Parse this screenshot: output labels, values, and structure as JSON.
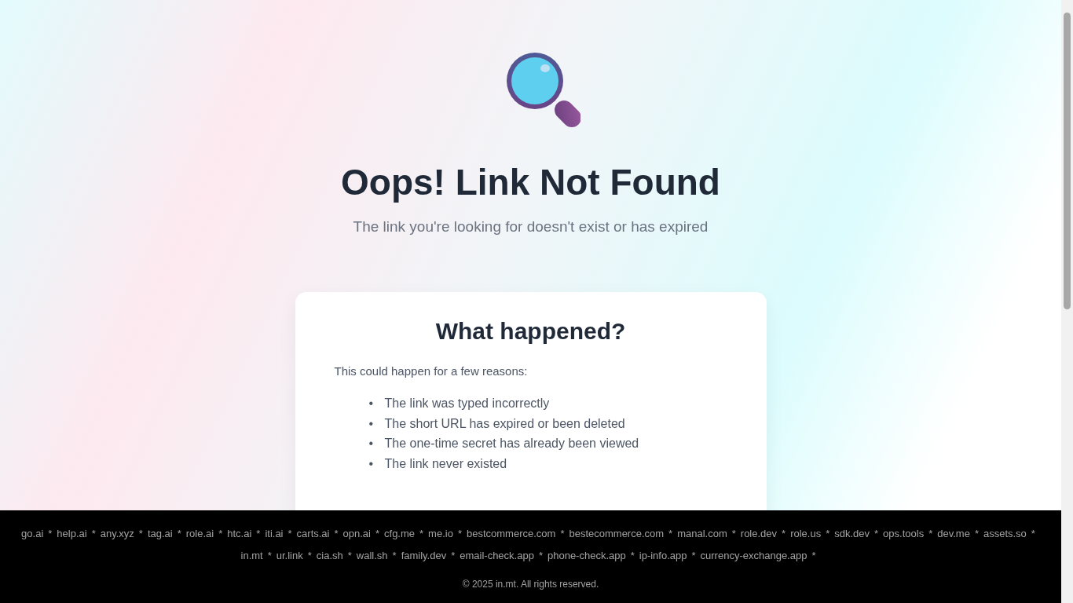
{
  "hero": {
    "title": "Oops! Link Not Found",
    "subtitle": "The link you're looking for doesn't exist or has expired"
  },
  "card": {
    "heading": "What happened?",
    "intro": "This could happen for a few reasons:",
    "reasons": [
      {
        "bullet": "•",
        "text": "The link was typed incorrectly"
      },
      {
        "bullet": "•",
        "text": "The short URL has expired or been deleted"
      },
      {
        "bullet": "•",
        "text": "The one-time secret has already been viewed"
      },
      {
        "bullet": "•",
        "text": "The link never existed"
      }
    ]
  },
  "footer": {
    "links": [
      {
        "label": "go.ai",
        "sep": "*"
      },
      {
        "label": "help.ai",
        "sep": "*"
      },
      {
        "label": "any.xyz",
        "sep": "*"
      },
      {
        "label": "tag.ai",
        "sep": "*"
      },
      {
        "label": "role.ai",
        "sep": "*"
      },
      {
        "label": "htc.ai",
        "sep": "*"
      },
      {
        "label": "iti.ai",
        "sep": "*"
      },
      {
        "label": "carts.ai",
        "sep": "*"
      },
      {
        "label": "opn.ai",
        "sep": "*"
      },
      {
        "label": "cfg.me",
        "sep": "*"
      },
      {
        "label": "me.io",
        "sep": "*"
      },
      {
        "label": "bestcommerce.com",
        "sep": "*"
      },
      {
        "label": "bestecommerce.com",
        "sep": "*"
      },
      {
        "label": "manal.com",
        "sep": "*"
      },
      {
        "label": "role.dev",
        "sep": "*"
      },
      {
        "label": "role.us",
        "sep": "*"
      },
      {
        "label": "sdk.dev",
        "sep": "*"
      },
      {
        "label": "ops.tools",
        "sep": "*"
      },
      {
        "label": "dev.me",
        "sep": "*"
      },
      {
        "label": "assets.so",
        "sep": "*"
      },
      {
        "label": "in.mt",
        "sep": "*"
      },
      {
        "label": "ur.link",
        "sep": "*"
      },
      {
        "label": "cia.sh",
        "sep": "*"
      },
      {
        "label": "wall.sh",
        "sep": "*"
      },
      {
        "label": "family.dev",
        "sep": "*"
      },
      {
        "label": "email-check.app",
        "sep": "*"
      },
      {
        "label": "phone-check.app",
        "sep": "*"
      },
      {
        "label": "ip-info.app",
        "sep": "*"
      },
      {
        "label": "currency-exchange.app",
        "sep": "*"
      }
    ],
    "copyright": "© 2025 in.mt. All rights reserved."
  }
}
